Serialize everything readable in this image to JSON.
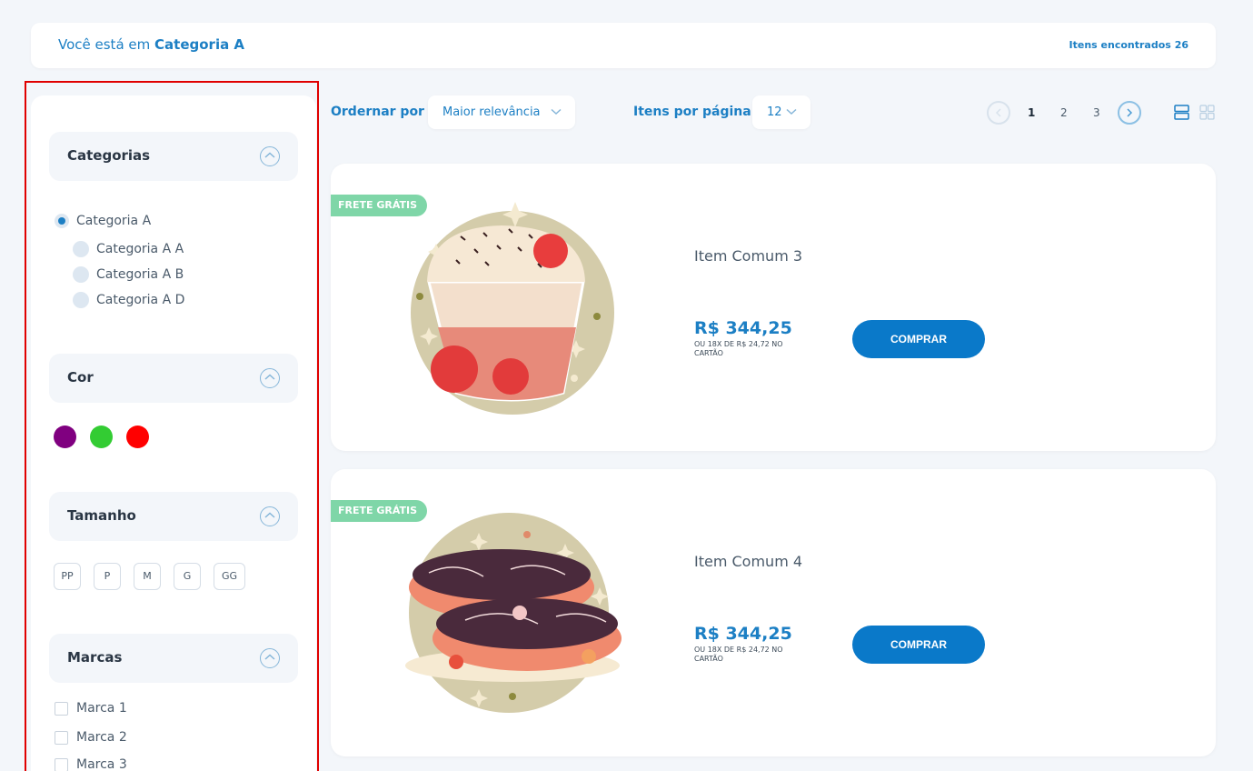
{
  "breadcrumb": {
    "prefix": "Você está em",
    "current": "Categoria A",
    "found_label": "Itens encontrados",
    "found_count": "26"
  },
  "filters": {
    "categories": {
      "title": "Categorias",
      "selected": "Categoria A",
      "children": [
        "Categoria A A",
        "Categoria A B",
        "Categoria A D"
      ]
    },
    "color": {
      "title": "Cor",
      "swatches": [
        "#800080",
        "#33cc33",
        "#ff0000"
      ]
    },
    "size": {
      "title": "Tamanho",
      "options": [
        "PP",
        "P",
        "M",
        "G",
        "GG"
      ]
    },
    "brands": {
      "title": "Marcas",
      "options": [
        "Marca 1",
        "Marca 2",
        "Marca 3"
      ]
    }
  },
  "toolbar": {
    "sort_label": "Ordernar por",
    "sort_value": "Maior relevância",
    "per_page_label": "Itens por página",
    "per_page_value": "12",
    "pages": [
      "1",
      "2",
      "3"
    ],
    "current_page": "1"
  },
  "products": [
    {
      "badge": "FRETE GRÁTIS",
      "name": "Item Comum 3",
      "price": "R$ 344,25",
      "installments": "OU 18X DE R$ 24,72 NO CARTÃO",
      "buy_label": "COMPRAR",
      "image": "cupcake-dessert-image"
    },
    {
      "badge": "FRETE GRÁTIS",
      "name": "Item Comum 4",
      "price": "R$ 344,25",
      "installments": "OU 18X DE R$ 24,72 NO CARTÃO",
      "buy_label": "COMPRAR",
      "image": "donuts-image"
    }
  ],
  "colors": {
    "accent": "#1c7fc4",
    "badge": "#7fd6a8",
    "button": "#0a79c9",
    "highlight_border": "#e00000"
  }
}
